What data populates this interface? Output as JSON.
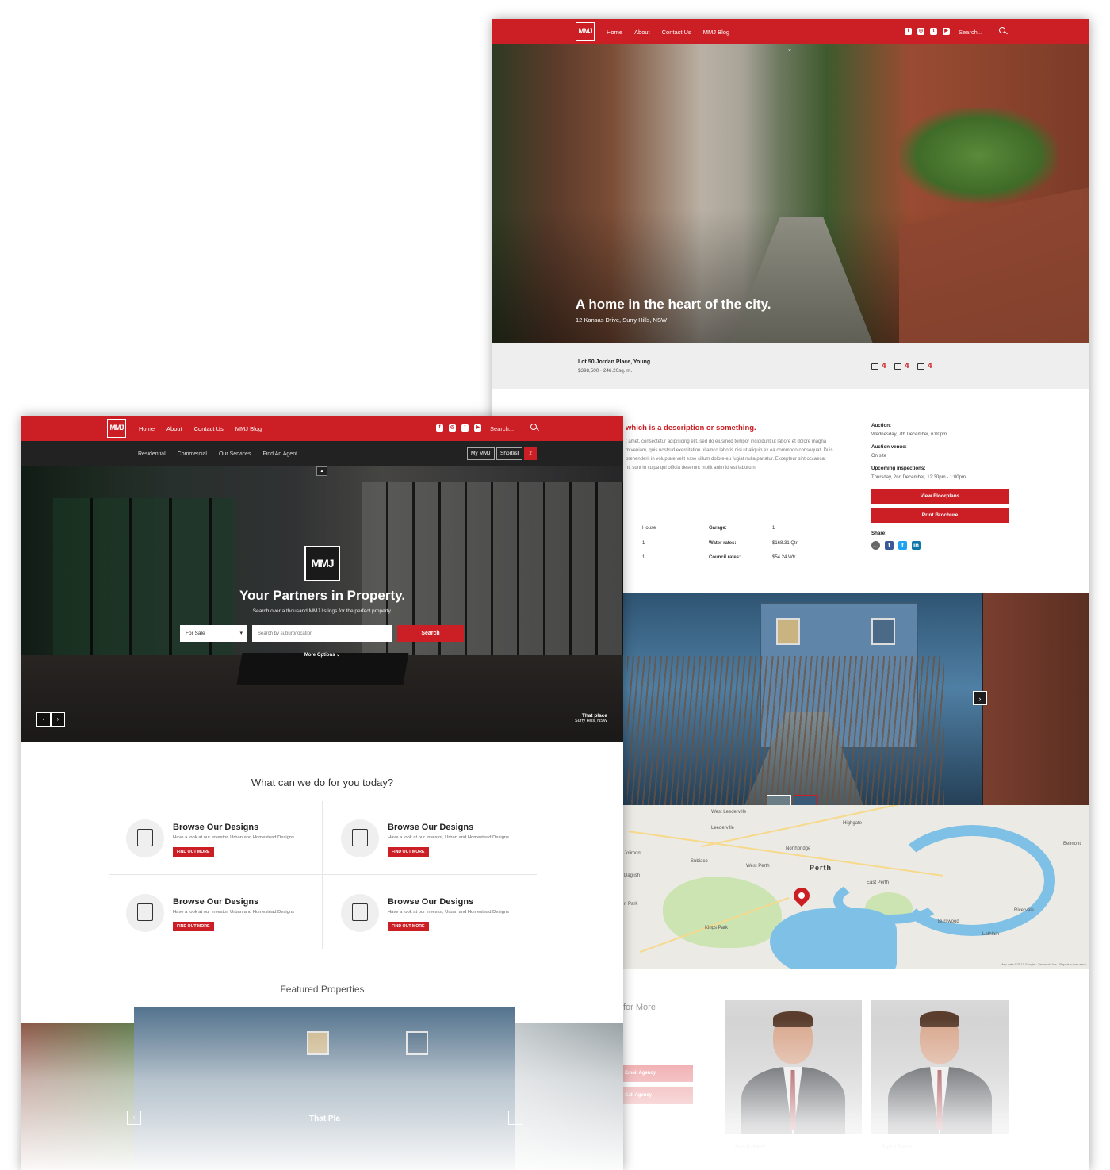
{
  "brand": {
    "logo_text": "MMJ",
    "accent": "#cc1f25",
    "dark": "#222222"
  },
  "top_nav": {
    "links": [
      "Home",
      "About",
      "Contact Us",
      "MMJ Blog"
    ],
    "social_icons": [
      "facebook-icon",
      "instagram-icon",
      "twitter-icon",
      "youtube-icon"
    ],
    "search_placeholder": "Search..."
  },
  "listing_page": {
    "hero": {
      "title": "A home in the heart of the city.",
      "address": "12 Kansas Drive, Surry Hills, NSW"
    },
    "summary": {
      "address": "Lot 50 Jordan Place, Young",
      "price": "$398,500 · 246.20sq. m.",
      "features": [
        {
          "icon": "bath-icon",
          "count": "4"
        },
        {
          "icon": "car-icon",
          "count": "4"
        },
        {
          "icon": "bed-icon",
          "count": "4"
        }
      ]
    },
    "description": {
      "title": "which is a description or something.",
      "lines": [
        "t amet, consectetur adipisicing elit, sed do eiusmod tempor incididunt ut labore et dolore magna",
        "m veniam, quis nostrud exercitation ullamco laboris nisi ut aliquip ex ea commodo consequat. Duis",
        "prehenderit in voluptate velit esse cillum dolore eu fugiat nulla pariatur. Excepteur sint occaecat",
        "nt, sunt in culpa qui officia deserunt mollit anim id est laborum."
      ]
    },
    "specs": [
      {
        "value": "House",
        "label": "Garage:",
        "label_value": "1"
      },
      {
        "value": "1",
        "label": "Water rates:",
        "label_value": "$168.31 Qtr"
      },
      {
        "value": "1",
        "label": "Council rates:",
        "label_value": "$54.24 Wtr"
      }
    ],
    "sidebar": {
      "auction_label": "Auction:",
      "auction_value": "Wednesday, 7th December, 6:00pm",
      "venue_label": "Auction venue:",
      "venue_value": "On site",
      "inspections_label": "Upcoming inspections:",
      "inspections_value": "Thursday, 2nd December, 12:30pm - 1:00pm",
      "floorplans_button": "View Floorplans",
      "brochure_button": "Print Brochure",
      "share_label": "Share:",
      "share_icons": [
        "chat-icon",
        "facebook-icon",
        "twitter-icon",
        "linkedin-icon"
      ]
    },
    "map": {
      "city": "Perth",
      "places": [
        "West Leederville",
        "Highgate",
        "Leederville",
        "Northbridge",
        "Belmont",
        "Subiaco",
        "West Perth",
        "East Perth",
        "Jolimont",
        "Daglish",
        "Kings Park",
        "Rivervale",
        "Burswood",
        "Lathlain",
        "n Park"
      ],
      "credit": "Map data ©2017 Google · Terms of Use · Report a map error"
    },
    "contact": {
      "heading": "for More",
      "email_button": "Email Agency",
      "call_button": "Call Agency",
      "agents": [
        {
          "name": "Agent Name"
        },
        {
          "name": "Agent Name"
        }
      ]
    }
  },
  "home_page": {
    "sub_nav": {
      "links": [
        "Residential",
        "Commercial",
        "Our Services",
        "Find An Agent"
      ],
      "my_mmj": "My MMJ",
      "shortlist": "Shortlist",
      "shortlist_count": "2"
    },
    "hero": {
      "tagline": "Your Partners in Property.",
      "subtitle": "Search over a thousand MMJ listings for the perfect property.",
      "select_value": "For Sale",
      "search_placeholder": "Search by suburb/location",
      "search_button": "Search",
      "more_options": "More Options",
      "place_name": "That place",
      "place_location": "Surry Hills, NSW"
    },
    "what_can_we_do": "What can we do for you today?",
    "services": [
      {
        "icon": "house-person-icon",
        "title": "Browse Our Designs",
        "desc": "Have a look at our Investor, Urban and Homestead Designs",
        "button": "FIND OUT MORE"
      },
      {
        "icon": "building-icon",
        "title": "Browse Our Designs",
        "desc": "Have a look at our Investor, Urban and Homestead Designs",
        "button": "FIND OUT MORE"
      },
      {
        "icon": "house-document-icon",
        "title": "Browse Our Designs",
        "desc": "Have a look at our Investor, Urban and Homestead Designs",
        "button": "FIND OUT MORE"
      },
      {
        "icon": "houses-icon",
        "title": "Browse Our Designs",
        "desc": "Have a look at our Investor, Urban and Homestead Designs",
        "button": "FIND OUT MORE"
      }
    ],
    "featured": {
      "heading": "Featured Properties",
      "property_name": "That Pla"
    }
  }
}
